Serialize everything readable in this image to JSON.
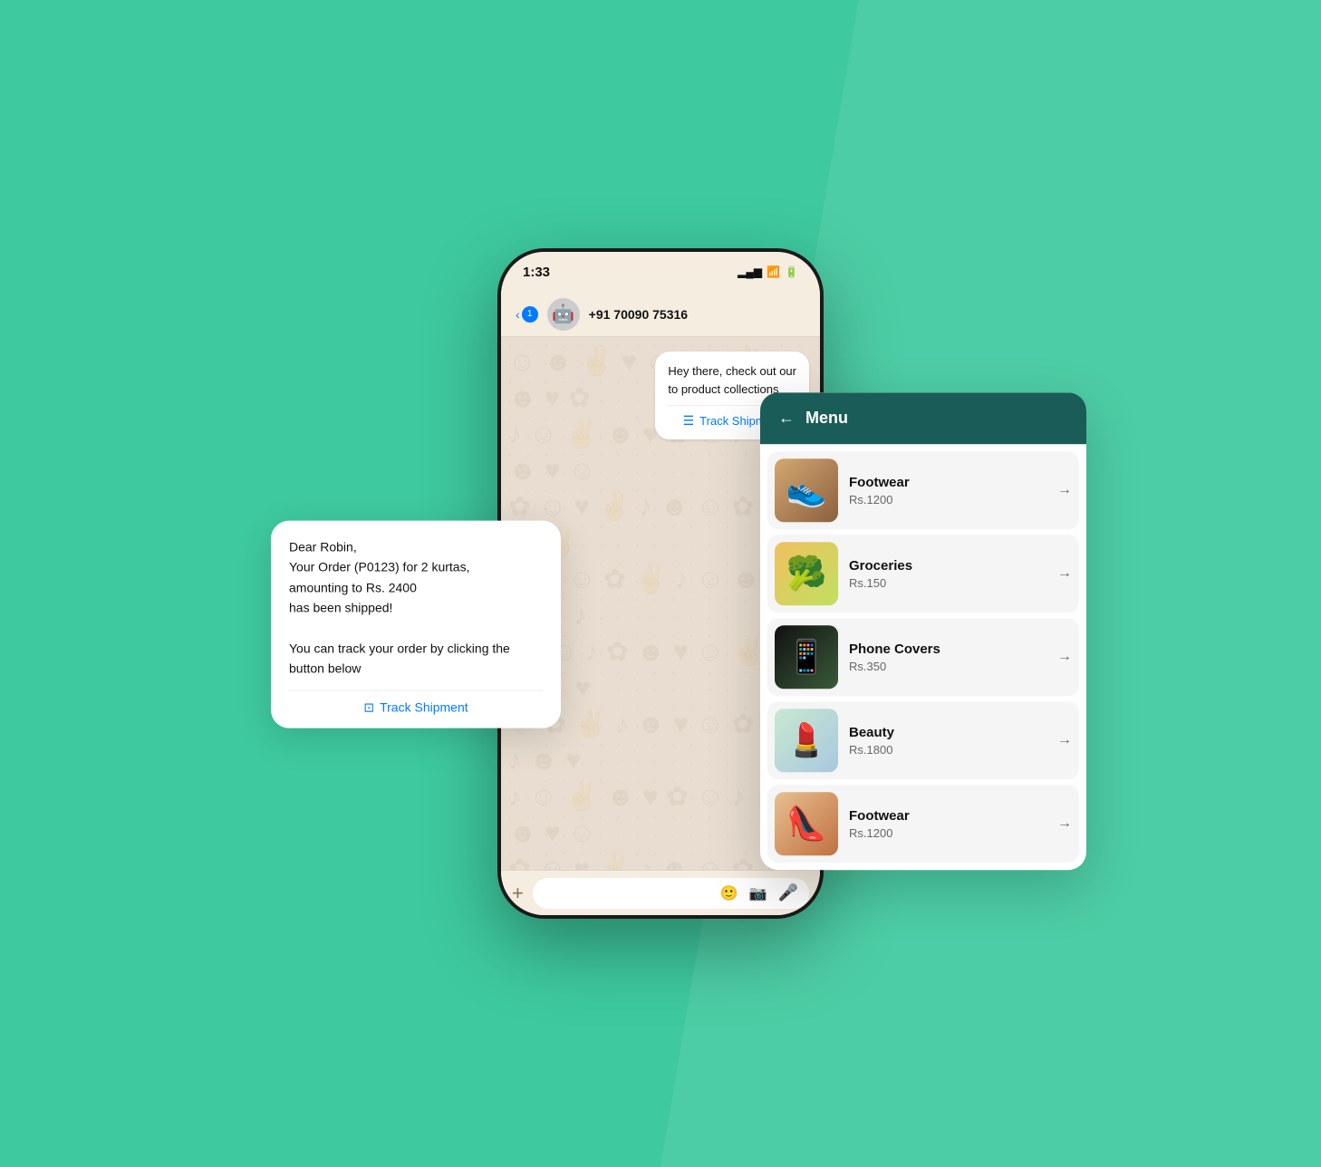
{
  "background": {
    "color": "#3ec99e"
  },
  "phone": {
    "status_time": "1:33",
    "status_signal": "▂▄▆",
    "status_wifi": "WiFi",
    "status_battery": "🔋",
    "nav_back": "<",
    "nav_badge": "1",
    "nav_phone_number": "+91 70090 75316",
    "chat_bubble_1_text": "Hey there, check out our\nto product collections",
    "chat_bubble_1_link": "Track Shipment",
    "input_plus": "+",
    "input_sticker": "🙂",
    "input_camera": "📷",
    "input_mic": "🎤"
  },
  "menu": {
    "title": "Menu",
    "back_arrow": "←",
    "items": [
      {
        "name": "Footwear",
        "price": "Rs.1200",
        "emoji": "👟"
      },
      {
        "name": "Groceries",
        "price": "Rs.150",
        "emoji": "🥦"
      },
      {
        "name": "Phone Covers",
        "price": "Rs.350",
        "emoji": "📱"
      },
      {
        "name": "Beauty",
        "price": "Rs.1800",
        "emoji": "💄"
      },
      {
        "name": "Footwear",
        "price": "Rs.1200",
        "emoji": "👠"
      }
    ]
  },
  "floating_bubble": {
    "line1": "Dear Robin,",
    "line2": "Your Order (P0123) for 2 kurtas,",
    "line3": "amounting to Rs. 2400",
    "line4": "has been shipped!",
    "line5": "",
    "line6": "You can track your order by clicking the",
    "line7": "button below",
    "link": "Track Shipment"
  }
}
